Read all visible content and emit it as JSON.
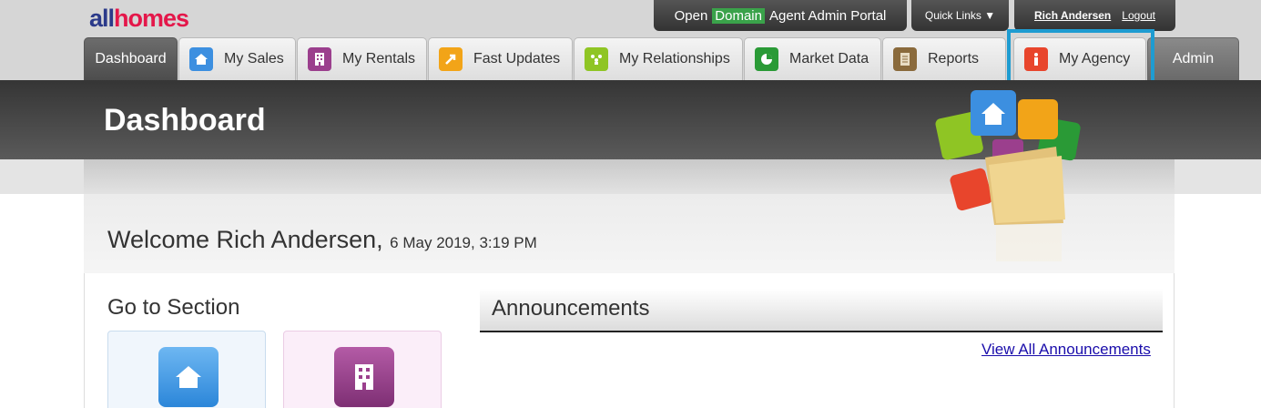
{
  "header": {
    "logo_all": "all",
    "logo_homes": "homes",
    "portal_prefix": "Open",
    "portal_domain": "Domain",
    "portal_suffix": "Agent Admin Portal",
    "quick_links": "Quick Links ▼",
    "user_name": "Rich Andersen",
    "logout": "Logout"
  },
  "tabs": [
    {
      "label": "Dashboard",
      "icon": "",
      "active": true
    },
    {
      "label": "My Sales",
      "icon": "house-icon",
      "color": "#3c8fe0"
    },
    {
      "label": "My Rentals",
      "icon": "building-icon",
      "color": "#9b3f8d"
    },
    {
      "label": "Fast Updates",
      "icon": "arrow-icon",
      "color": "#f2a418"
    },
    {
      "label": "My Relationships",
      "icon": "people-icon",
      "color": "#8fc524"
    },
    {
      "label": "Market Data",
      "icon": "pie-chart-icon",
      "color": "#2a9a36"
    },
    {
      "label": "Reports",
      "icon": "document-icon",
      "color": "#8a6a3c"
    },
    {
      "label": "My Agency",
      "icon": "info-icon",
      "color": "#e8452c"
    },
    {
      "label": "Admin",
      "icon": ""
    }
  ],
  "page": {
    "title": "Dashboard",
    "welcome": "Welcome Rich Andersen,",
    "date": "6 May 2019, 3:19 PM",
    "goto_section": "Go to Section",
    "announcements_title": "Announcements",
    "view_all": "View All Announcements"
  },
  "colors": {
    "highlight": "#1e9cd1",
    "brand_blue": "#2b3a8a",
    "brand_red": "#e4174a",
    "domain_green": "#3aa24a"
  }
}
